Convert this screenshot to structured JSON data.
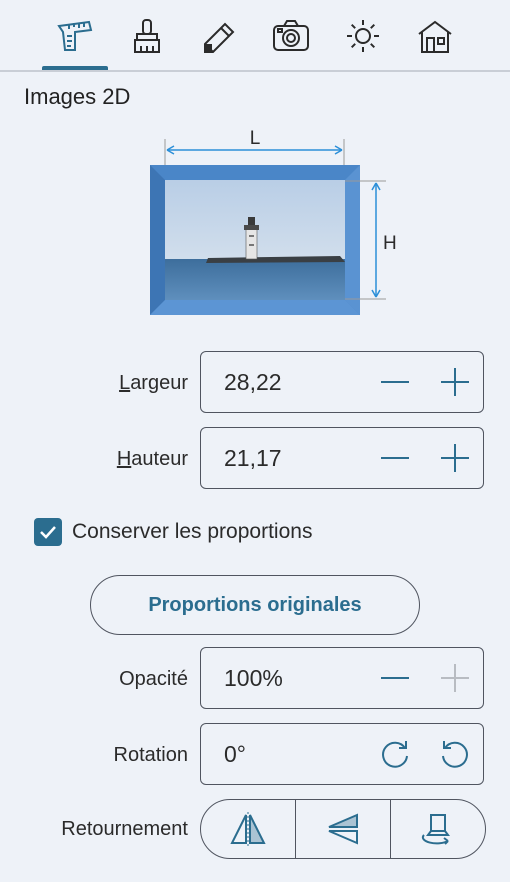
{
  "toolbar": {
    "tabs": [
      {
        "icon": "measure-icon",
        "active": true
      },
      {
        "icon": "brush-icon",
        "active": false
      },
      {
        "icon": "pencil-eraser-icon",
        "active": false
      },
      {
        "icon": "camera-icon",
        "active": false
      },
      {
        "icon": "sun-icon",
        "active": false
      },
      {
        "icon": "house-icon",
        "active": false
      }
    ]
  },
  "section": {
    "title": "Images 2D"
  },
  "preview": {
    "width_marker": "L",
    "height_marker": "H"
  },
  "fields": {
    "width": {
      "label_first": "L",
      "label_rest": "argeur",
      "value": "28,22"
    },
    "height": {
      "label_first": "H",
      "label_rest": "auteur",
      "value": "21,17"
    },
    "opacity": {
      "label": "Opacité",
      "value": "100%"
    },
    "rotation": {
      "label": "Rotation",
      "value": "0°"
    }
  },
  "keep_ratio": {
    "label": "Conserver les proportions",
    "checked": true
  },
  "original_button": {
    "label": "Proportions originales"
  },
  "flip": {
    "label": "Retournement"
  },
  "colors": {
    "accent": "#2b6d8f",
    "frame": "#4a86c8",
    "dimension": "#2b8fd8",
    "border": "#505560",
    "background": "#eef2f8"
  }
}
